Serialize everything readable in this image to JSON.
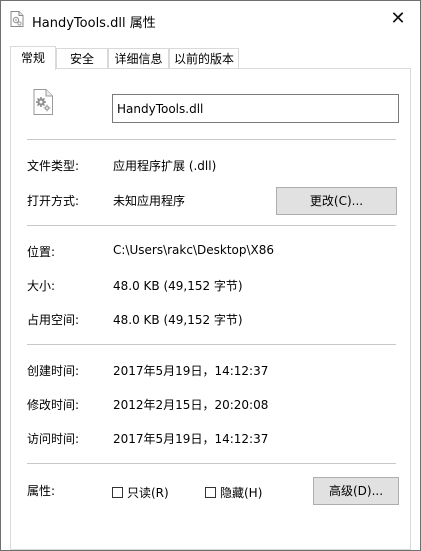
{
  "window": {
    "title": "HandyTools.dll 属性",
    "close_label": "✕"
  },
  "tabs": [
    {
      "label": "常规",
      "active": true
    },
    {
      "label": "安全",
      "active": false
    },
    {
      "label": "详细信息",
      "active": false
    },
    {
      "label": "以前的版本",
      "active": false
    }
  ],
  "general": {
    "file_name": "HandyTools.dll",
    "file_type_label": "文件类型:",
    "file_type_value": "应用程序扩展 (.dll)",
    "opens_with_label": "打开方式:",
    "opens_with_value": "未知应用程序",
    "change_button": "更改(C)...",
    "location_label": "位置:",
    "location_value": "C:\\Users\\rakc\\Desktop\\X86",
    "size_label": "大小:",
    "size_value": "48.0 KB (49,152 字节)",
    "size_on_disk_label": "占用空间:",
    "size_on_disk_value": "48.0 KB (49,152 字节)",
    "created_label": "创建时间:",
    "created_value": "2017年5月19日，14:12:37",
    "modified_label": "修改时间:",
    "modified_value": "2012年2月15日，20:20:08",
    "accessed_label": "访问时间:",
    "accessed_value": "2017年5月19日，14:12:37",
    "attributes_label": "属性:",
    "readonly_label": "只读(R)",
    "readonly_checked": false,
    "hidden_label": "隐藏(H)",
    "hidden_checked": false,
    "advanced_button": "高级(D)..."
  },
  "icons": {
    "title_icon": "dll-file-icon",
    "file_icon": "dll-file-gears-icon"
  }
}
